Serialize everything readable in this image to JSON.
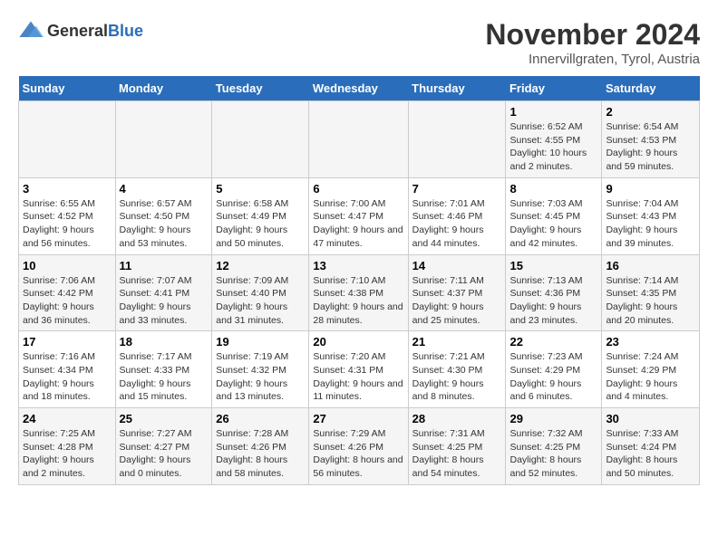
{
  "logo": {
    "general": "General",
    "blue": "Blue"
  },
  "title": {
    "month": "November 2024",
    "location": "Innervillgraten, Tyrol, Austria"
  },
  "headers": [
    "Sunday",
    "Monday",
    "Tuesday",
    "Wednesday",
    "Thursday",
    "Friday",
    "Saturday"
  ],
  "weeks": [
    [
      {
        "day": "",
        "info": ""
      },
      {
        "day": "",
        "info": ""
      },
      {
        "day": "",
        "info": ""
      },
      {
        "day": "",
        "info": ""
      },
      {
        "day": "",
        "info": ""
      },
      {
        "day": "1",
        "info": "Sunrise: 6:52 AM\nSunset: 4:55 PM\nDaylight: 10 hours and 2 minutes."
      },
      {
        "day": "2",
        "info": "Sunrise: 6:54 AM\nSunset: 4:53 PM\nDaylight: 9 hours and 59 minutes."
      }
    ],
    [
      {
        "day": "3",
        "info": "Sunrise: 6:55 AM\nSunset: 4:52 PM\nDaylight: 9 hours and 56 minutes."
      },
      {
        "day": "4",
        "info": "Sunrise: 6:57 AM\nSunset: 4:50 PM\nDaylight: 9 hours and 53 minutes."
      },
      {
        "day": "5",
        "info": "Sunrise: 6:58 AM\nSunset: 4:49 PM\nDaylight: 9 hours and 50 minutes."
      },
      {
        "day": "6",
        "info": "Sunrise: 7:00 AM\nSunset: 4:47 PM\nDaylight: 9 hours and 47 minutes."
      },
      {
        "day": "7",
        "info": "Sunrise: 7:01 AM\nSunset: 4:46 PM\nDaylight: 9 hours and 44 minutes."
      },
      {
        "day": "8",
        "info": "Sunrise: 7:03 AM\nSunset: 4:45 PM\nDaylight: 9 hours and 42 minutes."
      },
      {
        "day": "9",
        "info": "Sunrise: 7:04 AM\nSunset: 4:43 PM\nDaylight: 9 hours and 39 minutes."
      }
    ],
    [
      {
        "day": "10",
        "info": "Sunrise: 7:06 AM\nSunset: 4:42 PM\nDaylight: 9 hours and 36 minutes."
      },
      {
        "day": "11",
        "info": "Sunrise: 7:07 AM\nSunset: 4:41 PM\nDaylight: 9 hours and 33 minutes."
      },
      {
        "day": "12",
        "info": "Sunrise: 7:09 AM\nSunset: 4:40 PM\nDaylight: 9 hours and 31 minutes."
      },
      {
        "day": "13",
        "info": "Sunrise: 7:10 AM\nSunset: 4:38 PM\nDaylight: 9 hours and 28 minutes."
      },
      {
        "day": "14",
        "info": "Sunrise: 7:11 AM\nSunset: 4:37 PM\nDaylight: 9 hours and 25 minutes."
      },
      {
        "day": "15",
        "info": "Sunrise: 7:13 AM\nSunset: 4:36 PM\nDaylight: 9 hours and 23 minutes."
      },
      {
        "day": "16",
        "info": "Sunrise: 7:14 AM\nSunset: 4:35 PM\nDaylight: 9 hours and 20 minutes."
      }
    ],
    [
      {
        "day": "17",
        "info": "Sunrise: 7:16 AM\nSunset: 4:34 PM\nDaylight: 9 hours and 18 minutes."
      },
      {
        "day": "18",
        "info": "Sunrise: 7:17 AM\nSunset: 4:33 PM\nDaylight: 9 hours and 15 minutes."
      },
      {
        "day": "19",
        "info": "Sunrise: 7:19 AM\nSunset: 4:32 PM\nDaylight: 9 hours and 13 minutes."
      },
      {
        "day": "20",
        "info": "Sunrise: 7:20 AM\nSunset: 4:31 PM\nDaylight: 9 hours and 11 minutes."
      },
      {
        "day": "21",
        "info": "Sunrise: 7:21 AM\nSunset: 4:30 PM\nDaylight: 9 hours and 8 minutes."
      },
      {
        "day": "22",
        "info": "Sunrise: 7:23 AM\nSunset: 4:29 PM\nDaylight: 9 hours and 6 minutes."
      },
      {
        "day": "23",
        "info": "Sunrise: 7:24 AM\nSunset: 4:29 PM\nDaylight: 9 hours and 4 minutes."
      }
    ],
    [
      {
        "day": "24",
        "info": "Sunrise: 7:25 AM\nSunset: 4:28 PM\nDaylight: 9 hours and 2 minutes."
      },
      {
        "day": "25",
        "info": "Sunrise: 7:27 AM\nSunset: 4:27 PM\nDaylight: 9 hours and 0 minutes."
      },
      {
        "day": "26",
        "info": "Sunrise: 7:28 AM\nSunset: 4:26 PM\nDaylight: 8 hours and 58 minutes."
      },
      {
        "day": "27",
        "info": "Sunrise: 7:29 AM\nSunset: 4:26 PM\nDaylight: 8 hours and 56 minutes."
      },
      {
        "day": "28",
        "info": "Sunrise: 7:31 AM\nSunset: 4:25 PM\nDaylight: 8 hours and 54 minutes."
      },
      {
        "day": "29",
        "info": "Sunrise: 7:32 AM\nSunset: 4:25 PM\nDaylight: 8 hours and 52 minutes."
      },
      {
        "day": "30",
        "info": "Sunrise: 7:33 AM\nSunset: 4:24 PM\nDaylight: 8 hours and 50 minutes."
      }
    ]
  ]
}
